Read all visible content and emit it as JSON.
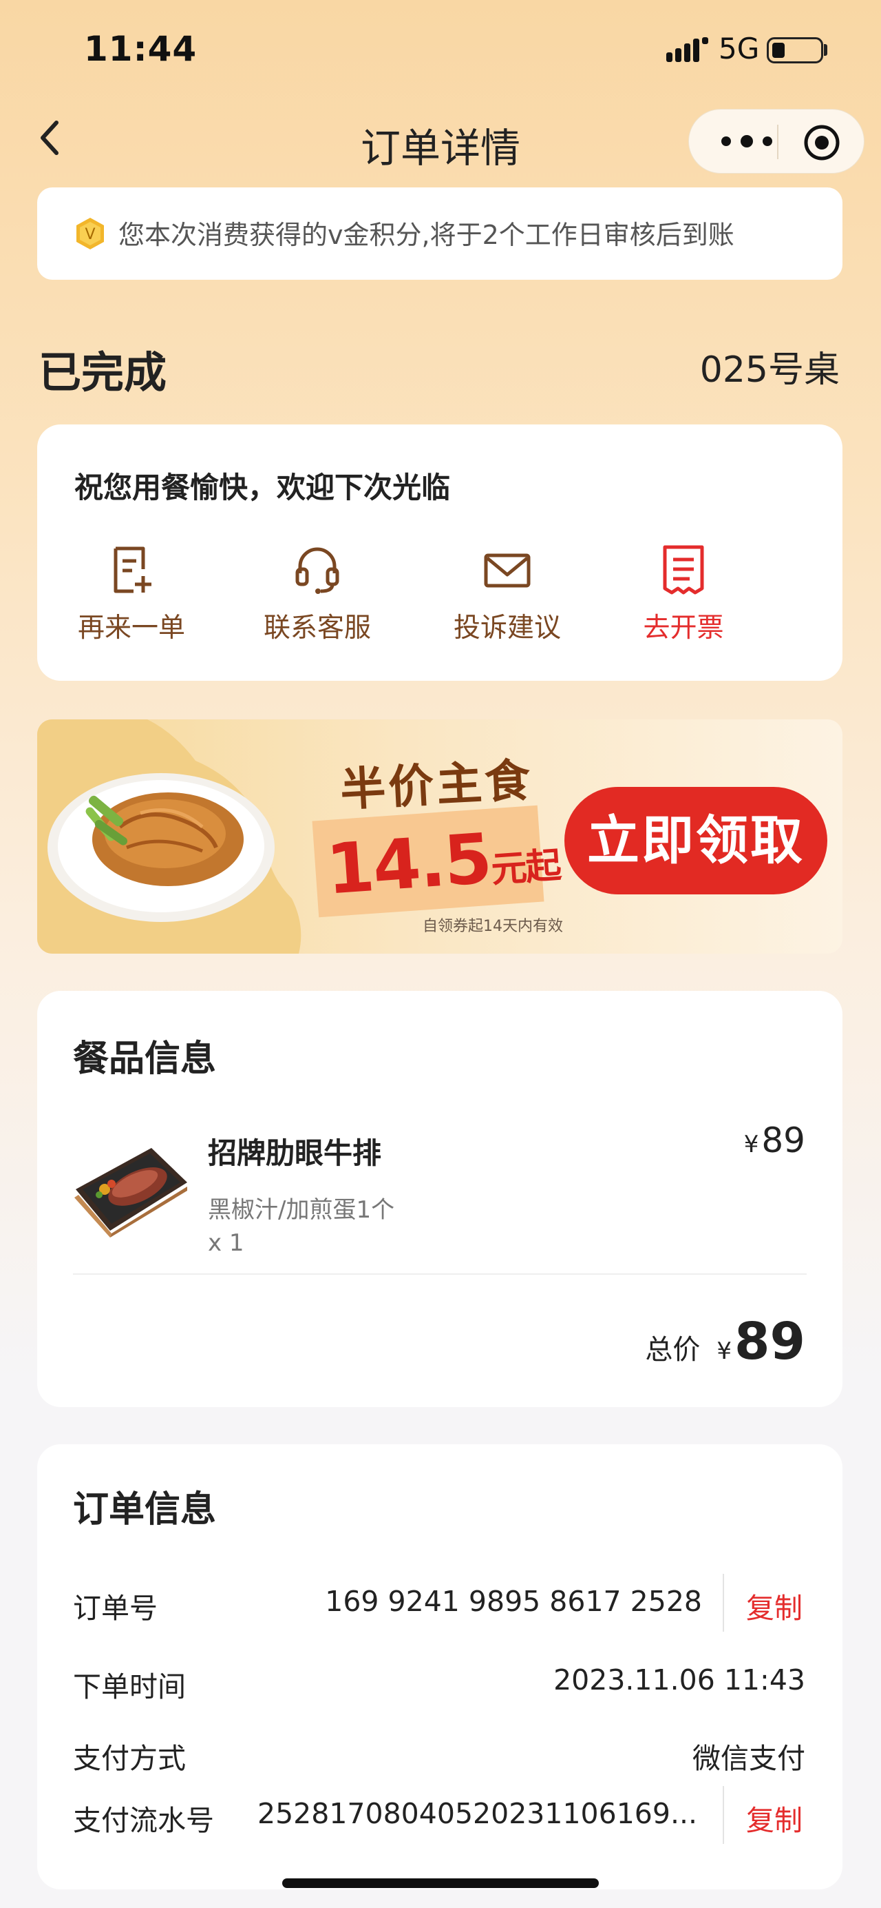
{
  "status_bar": {
    "time": "11:44",
    "network": "5G",
    "battery_level": 0.25
  },
  "nav": {
    "title": "订单详情",
    "back_icon": "chevron-left-icon",
    "more_icon": "more-dots-icon",
    "close_icon": "target-icon"
  },
  "notice": {
    "text": "您本次消费获得的v金积分,将于2个工作日审核后到账",
    "badge": "V"
  },
  "order_status": {
    "status": "已完成",
    "table": "025号桌"
  },
  "greeting": {
    "title": "祝您用餐愉快，欢迎下次光临",
    "actions": [
      {
        "label": "再来一单",
        "icon": "reorder-icon"
      },
      {
        "label": "联系客服",
        "icon": "headset-icon"
      },
      {
        "label": "投诉建议",
        "icon": "mail-icon"
      },
      {
        "label": "去开票",
        "icon": "invoice-icon",
        "color": "#e42c2c"
      }
    ]
  },
  "promo": {
    "headline": "半价主食",
    "price": "14.5",
    "price_unit": "元起",
    "cta": "立即领取",
    "fine_print": "自领券起14天内有效"
  },
  "food": {
    "title": "餐品信息",
    "items": [
      {
        "name": "招牌肋眼牛排",
        "spec": "黑椒汁/加煎蛋1个",
        "qty": "x 1",
        "currency": "¥",
        "price": "89"
      }
    ],
    "total_label": "总价",
    "total_currency": "¥",
    "total": "89"
  },
  "order_info": {
    "title": "订单信息",
    "rows": [
      {
        "label": "订单号",
        "value": "169 9241 9895 8617 2528",
        "action": "复制"
      },
      {
        "label": "下单时间",
        "value": "2023.11.06 11:43"
      },
      {
        "label": "支付方式",
        "value": "微信支付"
      },
      {
        "label": "支付流水号",
        "value": "2528170804052023110616​9...",
        "action": "复制"
      }
    ]
  },
  "colors": {
    "accent_red": "#e42c2c",
    "brown": "#7a4722",
    "promo_cta": "#e22a23"
  }
}
